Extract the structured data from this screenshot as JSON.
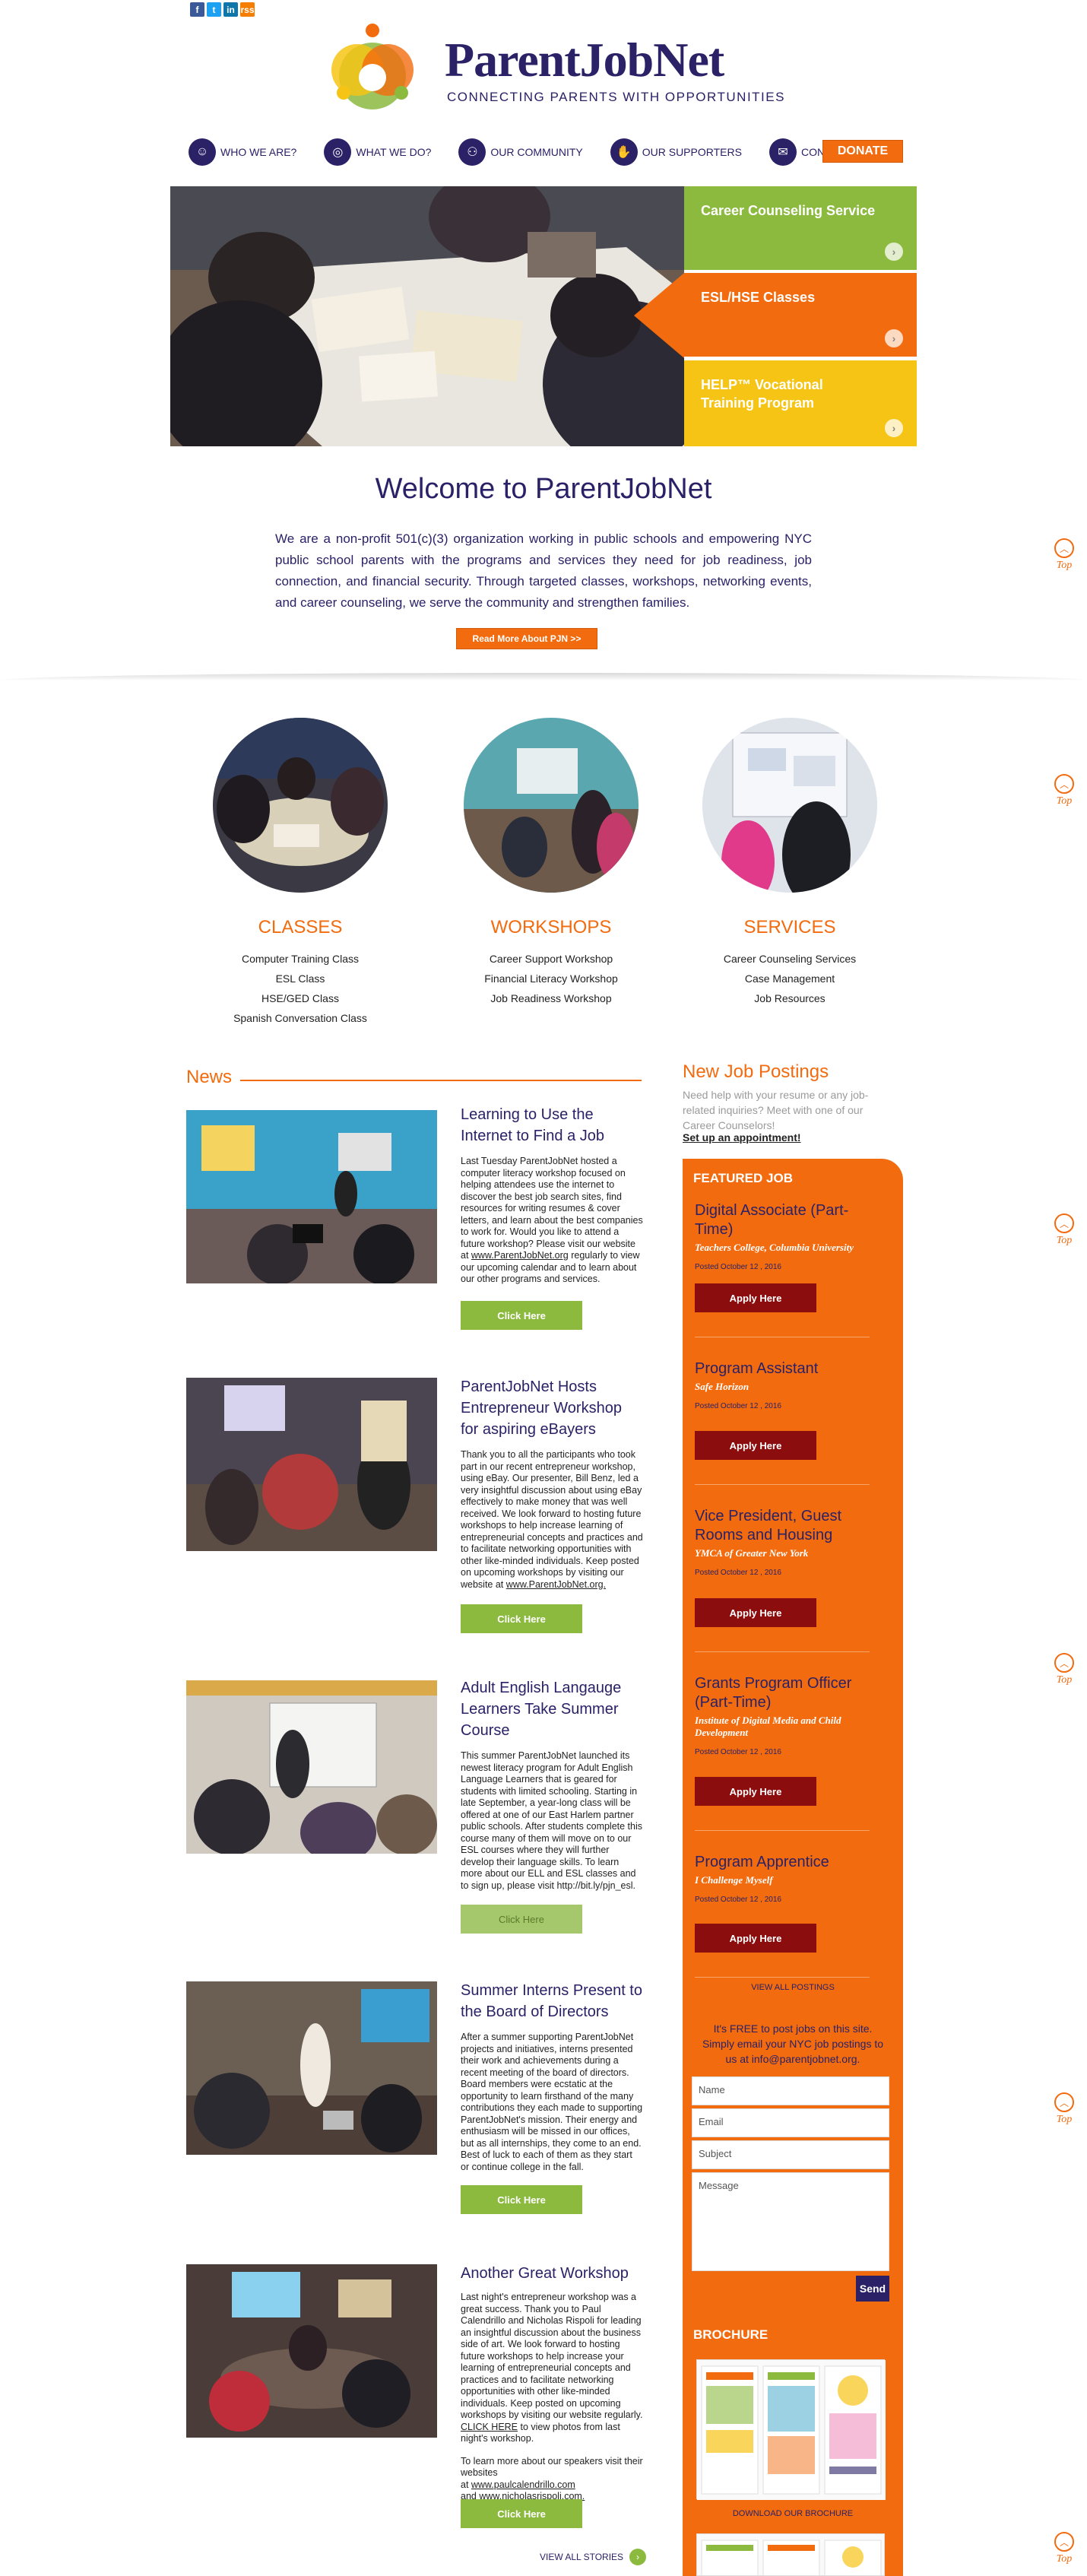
{
  "social": {
    "icons": [
      "f",
      "t",
      "in",
      "rss"
    ]
  },
  "brand": {
    "name": "ParentJobNet",
    "tagline": "CONNECTING PARENTS WITH OPPORTUNITIES",
    "colors": {
      "navy": "#2a2167",
      "orange": "#f26b0f",
      "green": "#8cba3f",
      "yellow": "#f6c415",
      "maroon": "#8b0d0d"
    }
  },
  "nav": {
    "items": [
      {
        "label": "WHO WE ARE?",
        "icon": "people-icon"
      },
      {
        "label": "WHAT WE DO?",
        "icon": "globe-icon"
      },
      {
        "label": "OUR COMMUNITY",
        "icon": "community-icon"
      },
      {
        "label": "OUR SUPPORTERS",
        "icon": "handshake-icon"
      },
      {
        "label": "CONTACT US",
        "icon": "mail-icon"
      }
    ],
    "donate": "DONATE"
  },
  "hero": {
    "tiles": [
      {
        "label": "Career Counseling Service"
      },
      {
        "label": "ESL/HSE Classes"
      },
      {
        "label": "HELP™ Vocational Training Program"
      }
    ]
  },
  "welcome": {
    "title": "Welcome to ParentJobNet",
    "text": "We are a non-profit 501(c)(3) organization working in public schools and empowering NYC public school parents with the programs and services they need for job readiness, job connection, and financial security. Through targeted classes, workshops, networking events, and career counseling, we serve the community and strengthen families.",
    "read_more": "Read More About PJN >>"
  },
  "top_label": "Top",
  "programs": [
    {
      "title": "CLASSES",
      "items": [
        "Computer Training Class",
        "ESL Class",
        "HSE/GED Class",
        "Spanish Conversation Class"
      ]
    },
    {
      "title": "WORKSHOPS",
      "items": [
        "Career Support Workshop",
        "Financial Literacy Workshop",
        "Job Readiness Workshop"
      ]
    },
    {
      "title": "SERVICES",
      "items": [
        "Career Counseling Services",
        "Case Management",
        "Job Resources"
      ]
    }
  ],
  "news": {
    "heading": "News",
    "click_label": "Click Here",
    "view_all": "VIEW ALL STORIES",
    "stories": [
      {
        "title": "Learning to Use the Internet to Find a Job",
        "body": "Last Tuesday ParentJobNet hosted a computer literacy workshop focused on helping attendees use the internet to discover the best job search sites, find resources for writing resumes & cover letters, and learn about the best companies to work for. Would you like to attend a future workshop? Please visit our website",
        "body_link_prefix": "at ",
        "body_link": "www.ParentJobNet.org",
        "body_tail": " regularly to view our upcoming calendar and to learn about our other programs and services."
      },
      {
        "title": "ParentJobNet Hosts Entrepreneur Workshop for aspiring eBayers",
        "body": "Thank you to all the participants who took part in our recent entrepreneur workshop, using eBay. Our presenter, Bill Benz, led a very insightful discussion about using eBay effectively to make money that was well received. We look forward to hosting future workshops to help increase learning of entrepreneurial concepts and practices and to facilitate networking opportunities with other like-minded individuals. Keep posted on upcoming workshops by visiting our website at ",
        "body_link": "www.ParentJobNet.org."
      },
      {
        "title": "Adult English Langauge Learners Take Summer Course",
        "body": "This summer ParentJobNet launched its newest literacy program for Adult English Language Learners that is geared for students with limited schooling.  Starting in late September, a year-long class will be offered at one of our East Harlem partner public schools. After students complete this course many of them will move on to our ESL courses where they will further develop their language skills.  To learn more about our ELL and ESL classes and to sign up, please visit http://bit.ly/pjn_esl."
      },
      {
        "title": "Summer Interns Present to the Board of Directors",
        "body": "After a summer supporting ParentJobNet projects and initiatives, interns presented their work and achievements during a recent meeting of the board of directors. Board members were ecstatic at the opportunity to learn firsthand of the many contributions they each made to supporting ParentJobNet's mission. Their energy and enthusiasm will be missed in our offices, but as all internships, they come to an end. Best of luck to each of them as they start or continue college in the fall."
      },
      {
        "title": "Another Great Workshop",
        "body": "Last night's entrepreneur workshop was a great success. Thank you to Paul Calendrillo and Nicholas Rispoli for leading an insightful discussion about the business side of art. We look forward to hosting future workshops to help increase your learning of entrepreneurial concepts and practices and to facilitate networking opportunities with other like-minded individuals. Keep posted on upcoming workshops by visiting our website regularly.  ",
        "body_link": "CLICK HERE",
        "body_tail": " to view photos from last night's workshop.",
        "body2": "To learn more about our speakers visit their websites",
        "link_a_prefix": "at ",
        "link_a": "www.paulcalendrillo.com",
        "link_b_prefix": "and ",
        "link_b": "www.nicholasrispoli.com."
      }
    ]
  },
  "jobs": {
    "heading": "New Job Postings",
    "intro": "Need help with your resume or any job-related inquiries? Meet with one of our Career Counselors!",
    "appointment": "Set up an appointment!",
    "featured": "FEATURED JOB",
    "apply_label": "Apply Here",
    "list": [
      {
        "title": "Digital Associate (Part-Time)",
        "employer": "Teachers College, Columbia University",
        "date": "Posted October 12 , 2016"
      },
      {
        "title": "Program Assistant",
        "employer": "Safe Horizon",
        "date": "Posted October 12 , 2016"
      },
      {
        "title": "Vice President, Guest Rooms and Housing",
        "employer": "YMCA of Greater New York",
        "date": "Posted October 12 , 2016"
      },
      {
        "title": "Grants Program Officer (Part-Time)",
        "employer": "Institute of Digital Media and Child Development",
        "date": "Posted October 12 , 2016"
      },
      {
        "title": "Program Apprentice",
        "employer": "I Challenge Myself",
        "date": "Posted October 12 , 2016"
      }
    ],
    "view_all": "VIEW ALL POSTINGS",
    "free_text": "It's FREE to post jobs on this site. Simply email your NYC job postings to us at info@parentjobnet.org."
  },
  "form": {
    "name": "Name",
    "email": "Email",
    "subject": "Subject",
    "message": "Message",
    "send": "Send"
  },
  "brochure": {
    "heading": "BROCHURE",
    "download": "DOWNLOAD OUR BROCHURE"
  }
}
